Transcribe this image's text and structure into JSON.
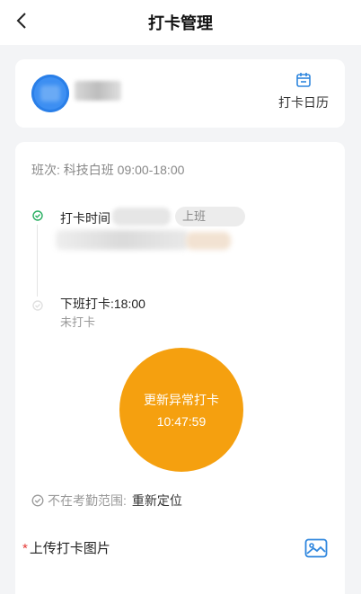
{
  "header": {
    "title": "打卡管理"
  },
  "profile_card": {
    "calendar_label": "打卡日历"
  },
  "attendance": {
    "shift_text": "班次: 科技白班 09:00-18:00",
    "checkin_label": "打卡时间",
    "checkin_tag": "上班",
    "checkout_title": "下班打卡:18:00",
    "checkout_status": "未打卡",
    "punch_button_line1": "更新异常打卡",
    "punch_button_time": "10:47:59",
    "location_status": "不在考勤范围:",
    "relocate_link": "重新定位",
    "upload_required_mark": "*",
    "upload_label": "上传打卡图片"
  },
  "colors": {
    "accent": "#f5a00f",
    "link_blue": "#2e86de",
    "success_green": "#27ae60"
  },
  "icons": [
    "back-icon",
    "calendar-icon",
    "check-circle-icon",
    "image-upload-icon"
  ]
}
